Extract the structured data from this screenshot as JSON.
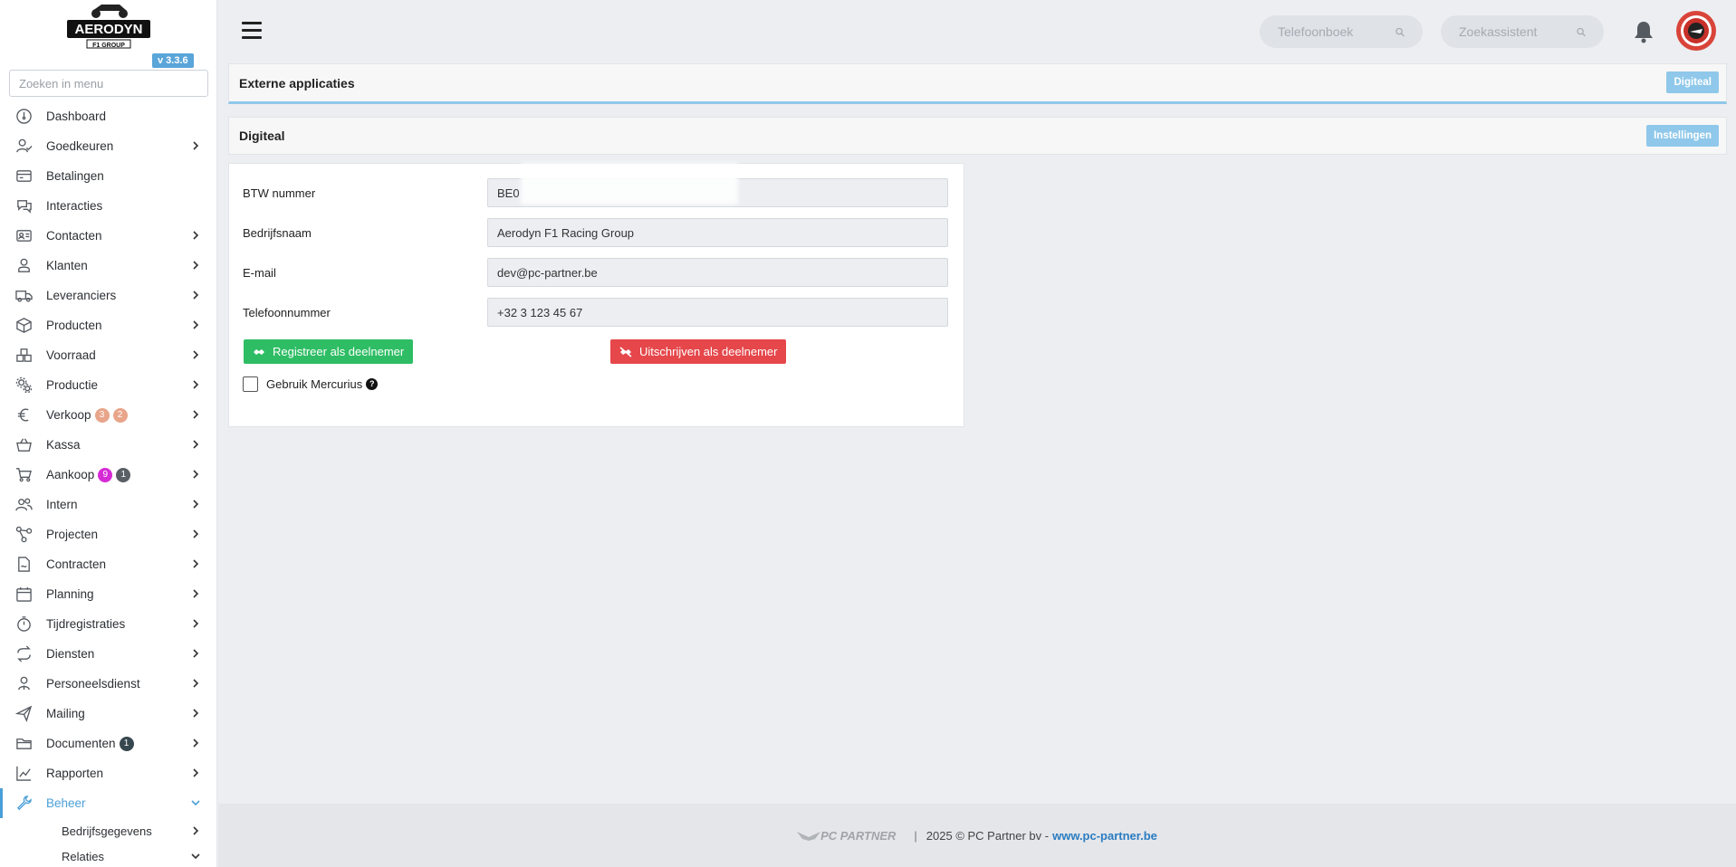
{
  "app": {
    "logo_text": "AERODYN",
    "logo_sub": "F1 GROUP",
    "version": "v 3.3.6"
  },
  "sidebar": {
    "search_placeholder": "Zoeken in menu",
    "items": [
      {
        "label": "Dashboard",
        "icon": "dashboard-icon"
      },
      {
        "label": "Goedkeuren",
        "icon": "user-check-icon",
        "chevron": true
      },
      {
        "label": "Betalingen",
        "icon": "payment-icon"
      },
      {
        "label": "Interacties",
        "icon": "chat-icon"
      },
      {
        "label": "Contacten",
        "icon": "contact-card-icon",
        "chevron": true
      },
      {
        "label": "Klanten",
        "icon": "customer-icon",
        "chevron": true
      },
      {
        "label": "Leveranciers",
        "icon": "truck-icon",
        "chevron": true
      },
      {
        "label": "Producten",
        "icon": "box-icon",
        "chevron": true
      },
      {
        "label": "Voorraad",
        "icon": "stock-icon",
        "chevron": true
      },
      {
        "label": "Productie",
        "icon": "gears-icon",
        "chevron": true
      },
      {
        "label": "Verkoop",
        "icon": "euro-icon",
        "chevron": true,
        "badges": [
          {
            "text": "3",
            "color": "#e8a58a"
          },
          {
            "text": "2",
            "color": "#e8a58a"
          }
        ]
      },
      {
        "label": "Kassa",
        "icon": "basket-icon",
        "chevron": true
      },
      {
        "label": "Aankoop",
        "icon": "cart-icon",
        "chevron": true,
        "badges": [
          {
            "text": "9",
            "color": "#d62ad6"
          },
          {
            "text": "1",
            "color": "#5a5f66"
          }
        ]
      },
      {
        "label": "Intern",
        "icon": "users-icon",
        "chevron": true
      },
      {
        "label": "Projecten",
        "icon": "project-icon",
        "chevron": true
      },
      {
        "label": "Contracten",
        "icon": "contract-icon",
        "chevron": true
      },
      {
        "label": "Planning",
        "icon": "calendar-icon",
        "chevron": true
      },
      {
        "label": "Tijdregistraties",
        "icon": "timer-icon",
        "chevron": true
      },
      {
        "label": "Diensten",
        "icon": "repeat-icon",
        "chevron": true
      },
      {
        "label": "Personeelsdienst",
        "icon": "staff-icon",
        "chevron": true
      },
      {
        "label": "Mailing",
        "icon": "send-icon",
        "chevron": true
      },
      {
        "label": "Documenten",
        "icon": "folder-icon",
        "chevron": true,
        "badges": [
          {
            "text": "1",
            "color": "#37474f"
          }
        ]
      },
      {
        "label": "Rapporten",
        "icon": "chart-icon",
        "chevron": true
      },
      {
        "label": "Beheer",
        "icon": "wrench-icon",
        "chevron": true,
        "active": true
      }
    ],
    "sub_items": [
      {
        "label": "Bedrijfsgegevens"
      },
      {
        "label": "Relaties"
      }
    ]
  },
  "topbar": {
    "phonebook_placeholder": "Telefoonboek",
    "assistant_placeholder": "Zoekassistent"
  },
  "external_apps": {
    "title": "Externe applicaties",
    "button": "Digiteal"
  },
  "digiteal": {
    "title": "Digiteal",
    "button": "Instellingen"
  },
  "form": {
    "vat_label": "BTW nummer",
    "vat_value": "BE0",
    "company_label": "Bedrijfsnaam",
    "company_value": "Aerodyn F1 Racing Group",
    "email_label": "E-mail",
    "email_value": "dev@pc-partner.be",
    "phone_label": "Telefoonnummer",
    "phone_value": "+32 3 123 45 67",
    "register_button": "Registreer als deelnemer",
    "unregister_button": "Uitschrijven als deelnemer",
    "mercurius_label": "Gebruik Mercurius"
  },
  "footer": {
    "brand": "PC PARTNER",
    "copyright": "2025 © PC Partner bv -",
    "link": "www.pc-partner.be"
  }
}
